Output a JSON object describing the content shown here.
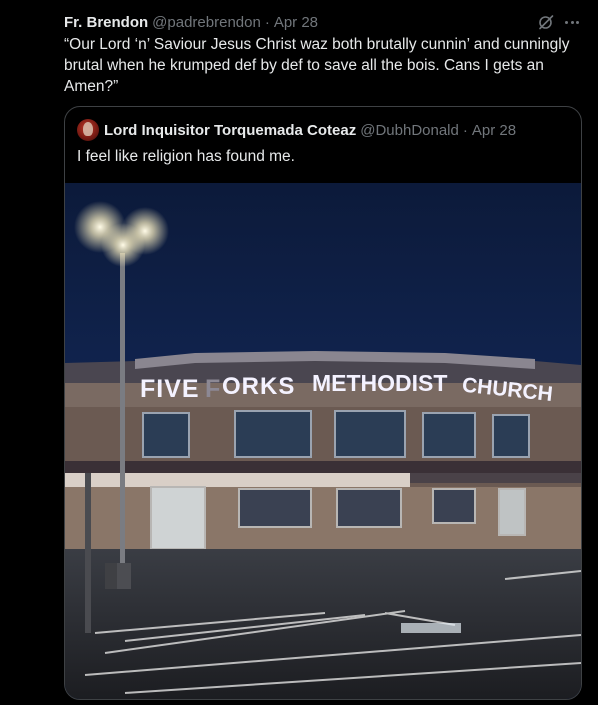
{
  "tweet": {
    "author_name": "Fr. Brendon",
    "author_handle": "@padrebrendon",
    "separator": "·",
    "date": "Apr 28",
    "text": "“Our Lord ‘n’ Saviour Jesus Christ waz both brutally cunnin’ and cunningly brutal when he krumped def by def to save all the bois. Cans I gets an Amen?”",
    "icons": {
      "grok": "grok-icon",
      "more": "more-icon"
    }
  },
  "quote": {
    "author_name": "Lord Inquisitor Torquemada Coteaz",
    "author_handle": "@DubhDonald",
    "separator": "·",
    "date": "Apr 28",
    "text": "I feel like religion has found me.",
    "photo": {
      "sign_text": "FIVE FORKS METHODIST CHURCH"
    }
  },
  "colors": {
    "background": "#000000",
    "text": "#e7e9ea",
    "secondary": "#71767b",
    "border": "#3e4144"
  }
}
